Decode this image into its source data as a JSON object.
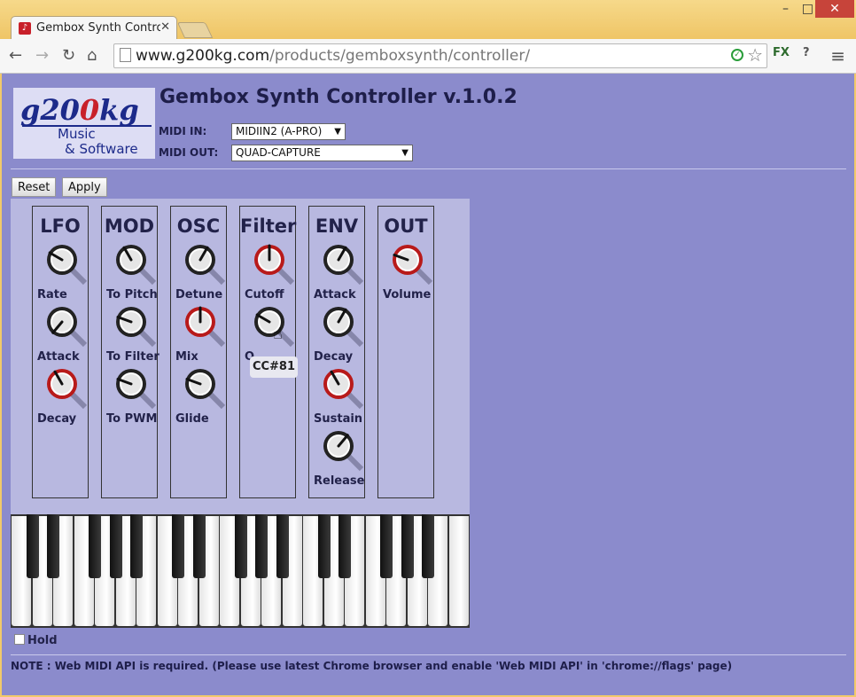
{
  "browser": {
    "tab_title": "Gembox Synth Controll",
    "tab_close": "✕",
    "url_domain": "www.g200kg.com",
    "url_path": "/products/gemboxsynth/controller/",
    "ext_label": "FX",
    "ext2_label": "?"
  },
  "header": {
    "title": "Gembox Synth Controller v.1.0.2",
    "logo_main_a": "g20",
    "logo_main_b": "0",
    "logo_main_c": "kg",
    "logo_line1": "Music",
    "logo_line2": "& Software",
    "midi_in_label": "MIDI IN:",
    "midi_in_value": "MIDIIN2 (A-PRO)",
    "midi_out_label": "MIDI OUT:",
    "midi_out_value": "QUAD-CAPTURE"
  },
  "buttons": {
    "reset": "Reset",
    "apply": "Apply"
  },
  "groups": [
    {
      "title": "LFO",
      "knobs": [
        {
          "label": "Rate",
          "angle": -60,
          "red": false
        },
        {
          "label": "Attack",
          "angle": -140,
          "red": false
        },
        {
          "label": "Decay",
          "angle": -30,
          "red": true
        }
      ]
    },
    {
      "title": "MOD",
      "knobs": [
        {
          "label": "To Pitch",
          "angle": -30,
          "red": false
        },
        {
          "label": "To Filter",
          "angle": -70,
          "red": false
        },
        {
          "label": "To PWM",
          "angle": -70,
          "red": false
        }
      ]
    },
    {
      "title": "OSC",
      "knobs": [
        {
          "label": "Detune",
          "angle": 30,
          "red": false
        },
        {
          "label": "Mix",
          "angle": 0,
          "red": true
        },
        {
          "label": "Glide",
          "angle": -70,
          "red": false
        }
      ]
    },
    {
      "title": "Filter",
      "knobs": [
        {
          "label": "Cutoff",
          "angle": 0,
          "red": true
        },
        {
          "label": "Q",
          "angle": -60,
          "red": false
        }
      ]
    },
    {
      "title": "ENV",
      "knobs": [
        {
          "label": "Attack",
          "angle": 30,
          "red": false
        },
        {
          "label": "Decay",
          "angle": 30,
          "red": false
        },
        {
          "label": "Sustain",
          "angle": -30,
          "red": true
        },
        {
          "label": "Release",
          "angle": 40,
          "red": false
        }
      ]
    },
    {
      "title": "OUT",
      "knobs": [
        {
          "label": "Volume",
          "angle": -70,
          "red": true
        }
      ]
    }
  ],
  "tooltip": "CC#81",
  "hold_label": "Hold",
  "note": "NOTE : Web MIDI API is required. (Please use latest Chrome browser and enable 'Web MIDI API' in 'chrome://flags' page)"
}
